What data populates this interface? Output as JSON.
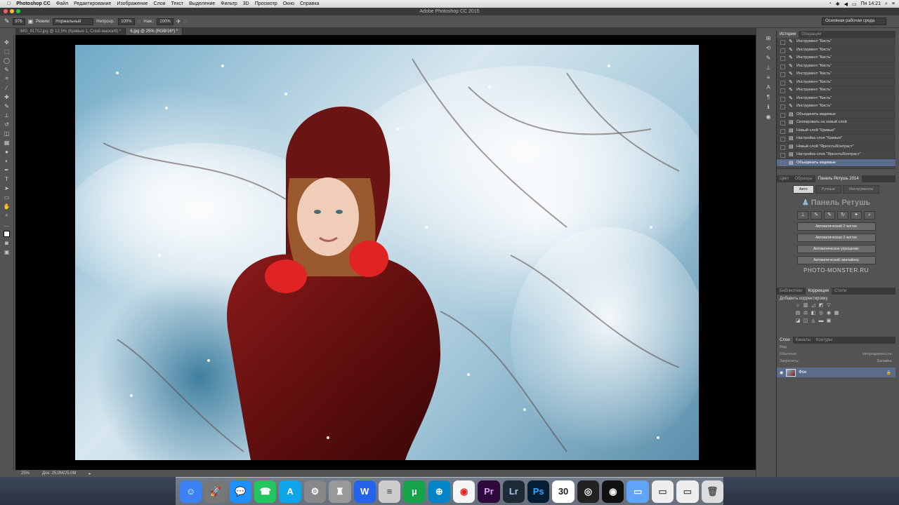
{
  "menubar": {
    "apple": "",
    "app": "Photoshop CC",
    "items": [
      "Файл",
      "Редактирование",
      "Изображение",
      "Слои",
      "Текст",
      "Выделение",
      "Фильтр",
      "3D",
      "Просмотр",
      "Окно",
      "Справка"
    ],
    "clock": "Пн 14:21"
  },
  "window": {
    "title": "Adobe Photoshop CC 2015"
  },
  "options": {
    "brush_size": "976",
    "mode_label": "Режим:",
    "mode_value": "Нормальный",
    "opacity_label": "Непрозр.:",
    "opacity_value": "100%",
    "flow_label": "Наж.:",
    "flow_value": "100%",
    "workspace": "Основная рабочая среда"
  },
  "doc_tabs": [
    {
      "label": "IMG_9170J.jpg @ 12,5% (Кривые 1, Слой-маска/8) *",
      "active": false
    },
    {
      "label": "6.jpg @ 25% (RGB/16*) *",
      "active": true
    }
  ],
  "status": {
    "zoom": "25%",
    "doc": "Док: 25,0M/25,0M"
  },
  "history": {
    "tabs": [
      "История",
      "Операции"
    ],
    "items": [
      "Инструмент \"Кисть\"",
      "Инструмент \"Кисть\"",
      "Инструмент \"Кисть\"",
      "Инструмент \"Кисть\"",
      "Инструмент \"Кисть\"",
      "Инструмент \"Кисть\"",
      "Инструмент \"Кисть\"",
      "Инструмент \"Кисть\"",
      "Инструмент \"Кисть\"",
      "Объединить видимые",
      "Скопировать на новый слой",
      "Новый слой \"Кривые\"",
      "Настройка слоя \"Кривые\"",
      "Новый слой \"Яркость/Контраст\"",
      "Настройка слоя \"Яркость/Контраст\"",
      "Объединить видимые"
    ]
  },
  "retouch": {
    "tabs": [
      "Цвет",
      "Образцы",
      "Панель Ретушь 2014"
    ],
    "modes": [
      "Авто",
      "Ручные",
      "Инструменты"
    ],
    "title": "Панель Ретушь",
    "buttons": [
      "Автоматический 2 чистка",
      "Автоматическая 3 чистка",
      "Автоматическое упрощение",
      "Автоматический эмилайнер"
    ],
    "site": "PHOTO-MONSTER.RU"
  },
  "adjustments": {
    "tabs": [
      "Библиотеки",
      "Коррекция",
      "Стили"
    ],
    "heading": "Добавить корректировку"
  },
  "layers": {
    "tabs": [
      "Слои",
      "Каналы",
      "Контуры"
    ],
    "kind": "Вид",
    "blend": "Обычные",
    "opacity_label": "Непрозрачность:",
    "lock_label": "Закрепить:",
    "fill_label": "Заливка:",
    "layer_name": "Фон"
  },
  "dock": {
    "calendar_day": "30"
  }
}
